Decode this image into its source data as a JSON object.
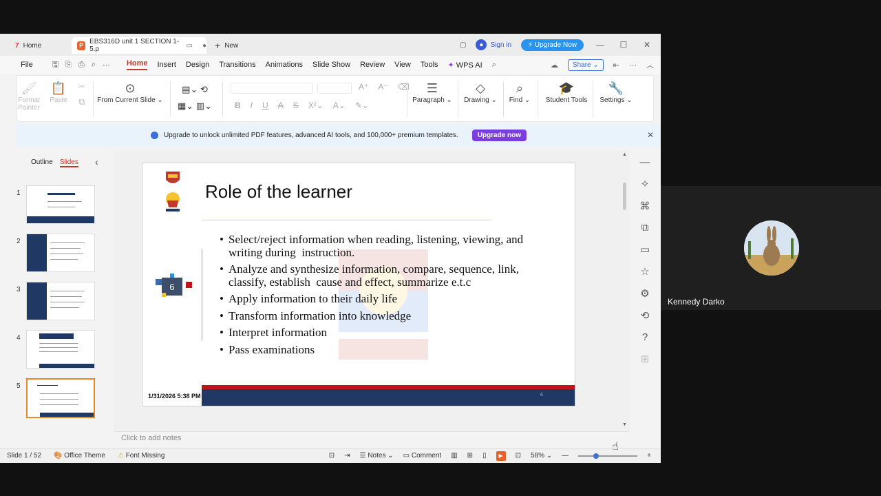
{
  "titlebar": {
    "home_tab": "Home",
    "doc_tab": "EBS316D unit 1 SECTION 1-5.p",
    "new_tab": "New",
    "signin": "Sign in",
    "upgrade": "Upgrade Now"
  },
  "menu": {
    "file": "File",
    "items": [
      "Home",
      "Insert",
      "Design",
      "Transitions",
      "Animations",
      "Slide Show",
      "Review",
      "View",
      "Tools"
    ],
    "wps_ai": "WPS AI",
    "share": "Share"
  },
  "ribbon": {
    "format_painter": "Format Painter",
    "paste": "Paste",
    "from_current": "From Current Slide",
    "paragraph": "Paragraph",
    "drawing": "Drawing",
    "find": "Find",
    "student_tools": "Student Tools",
    "settings": "Settings"
  },
  "banner": {
    "text": "Upgrade to unlock unlimited PDF features, advanced AI tools, and 100,000+ premium templates.",
    "button": "Upgrade now"
  },
  "pane": {
    "outline": "Outline",
    "slides": "Slides",
    "thumb_nums": [
      "1",
      "2",
      "3",
      "4",
      "5"
    ]
  },
  "slide": {
    "title": "Role of the learner",
    "number_badge": "6",
    "bullets": [
      "Select/reject information when reading, listening, viewing, and  writing during  instruction.",
      "Analyze and synthesize information, compare, sequence, link,  classify, establish  cause and effect, summarize e.t.c",
      "Apply information to their daily life",
      "Transform information into knowledge",
      "Interpret information",
      "Pass examinations"
    ],
    "footer_date": "1/31/2026 5:38 PM",
    "footer_num": "6"
  },
  "notes_placeholder": "Click to add notes",
  "status": {
    "slide_count": "Slide 1 / 52",
    "theme": "Office Theme",
    "font_missing": "Font Missing",
    "notes": "Notes",
    "comment": "Comment",
    "zoom": "58%"
  },
  "participant": {
    "name": "Kennedy Darko"
  },
  "colors": {
    "accent_red": "#c0392b",
    "slide_footer_blue": "#1f3864",
    "slide_footer_red": "#c0141c",
    "upgrade_blue": "#2a93ee",
    "banner_purple": "#7b3fe0"
  }
}
